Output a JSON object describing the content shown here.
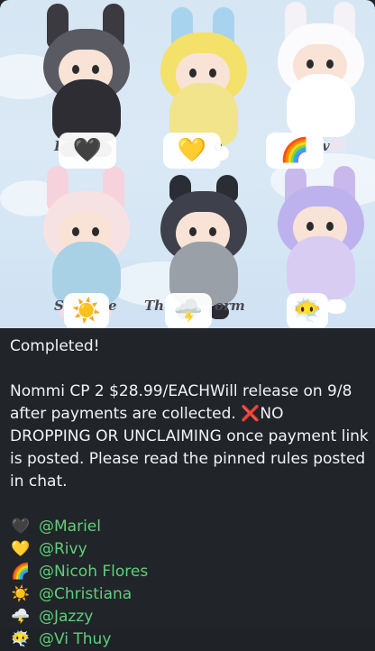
{
  "post_image": {
    "dolls": [
      {
        "emoji": "🖤",
        "label_left": "I",
        "label_right": ""
      },
      {
        "emoji": "💛",
        "label_left": "",
        "label_right": "e"
      },
      {
        "emoji": "🌈",
        "label_left": "",
        "label_right": "v"
      },
      {
        "emoji": "☀️",
        "label_left": "S",
        "label_right": "e"
      },
      {
        "emoji": "🌩️",
        "label_left": "Th",
        "label_right": "orm"
      },
      {
        "emoji": "😶‍🌫️",
        "label_left": "",
        "label_right": ""
      }
    ]
  },
  "message": {
    "status": "Completed!",
    "body_part1": "Nommi CP 2 $28.99/EACHWill release on 9/8 after payments are collected. ",
    "x_emoji": "❌",
    "body_part2": "NO DROPPING OR UNCLAIMING once payment link is posted. Please read the pinned rules posted in chat.",
    "claims": [
      {
        "emoji": "🖤",
        "mention": "@Mariel"
      },
      {
        "emoji": "💛",
        "mention": "@Rivy"
      },
      {
        "emoji": "🌈",
        "mention": "@Nicoh Flores"
      },
      {
        "emoji": "☀️",
        "mention": "@Christiana"
      },
      {
        "emoji": "🌩️",
        "mention": "@Jazzy"
      },
      {
        "emoji": "😶‍🌫️",
        "mention": "@Vi Thuy"
      }
    ]
  },
  "colors": {
    "background": "#212529",
    "text": "#f1f3f5",
    "mention": "#5fcf7a",
    "x_mark": "#e53935"
  }
}
